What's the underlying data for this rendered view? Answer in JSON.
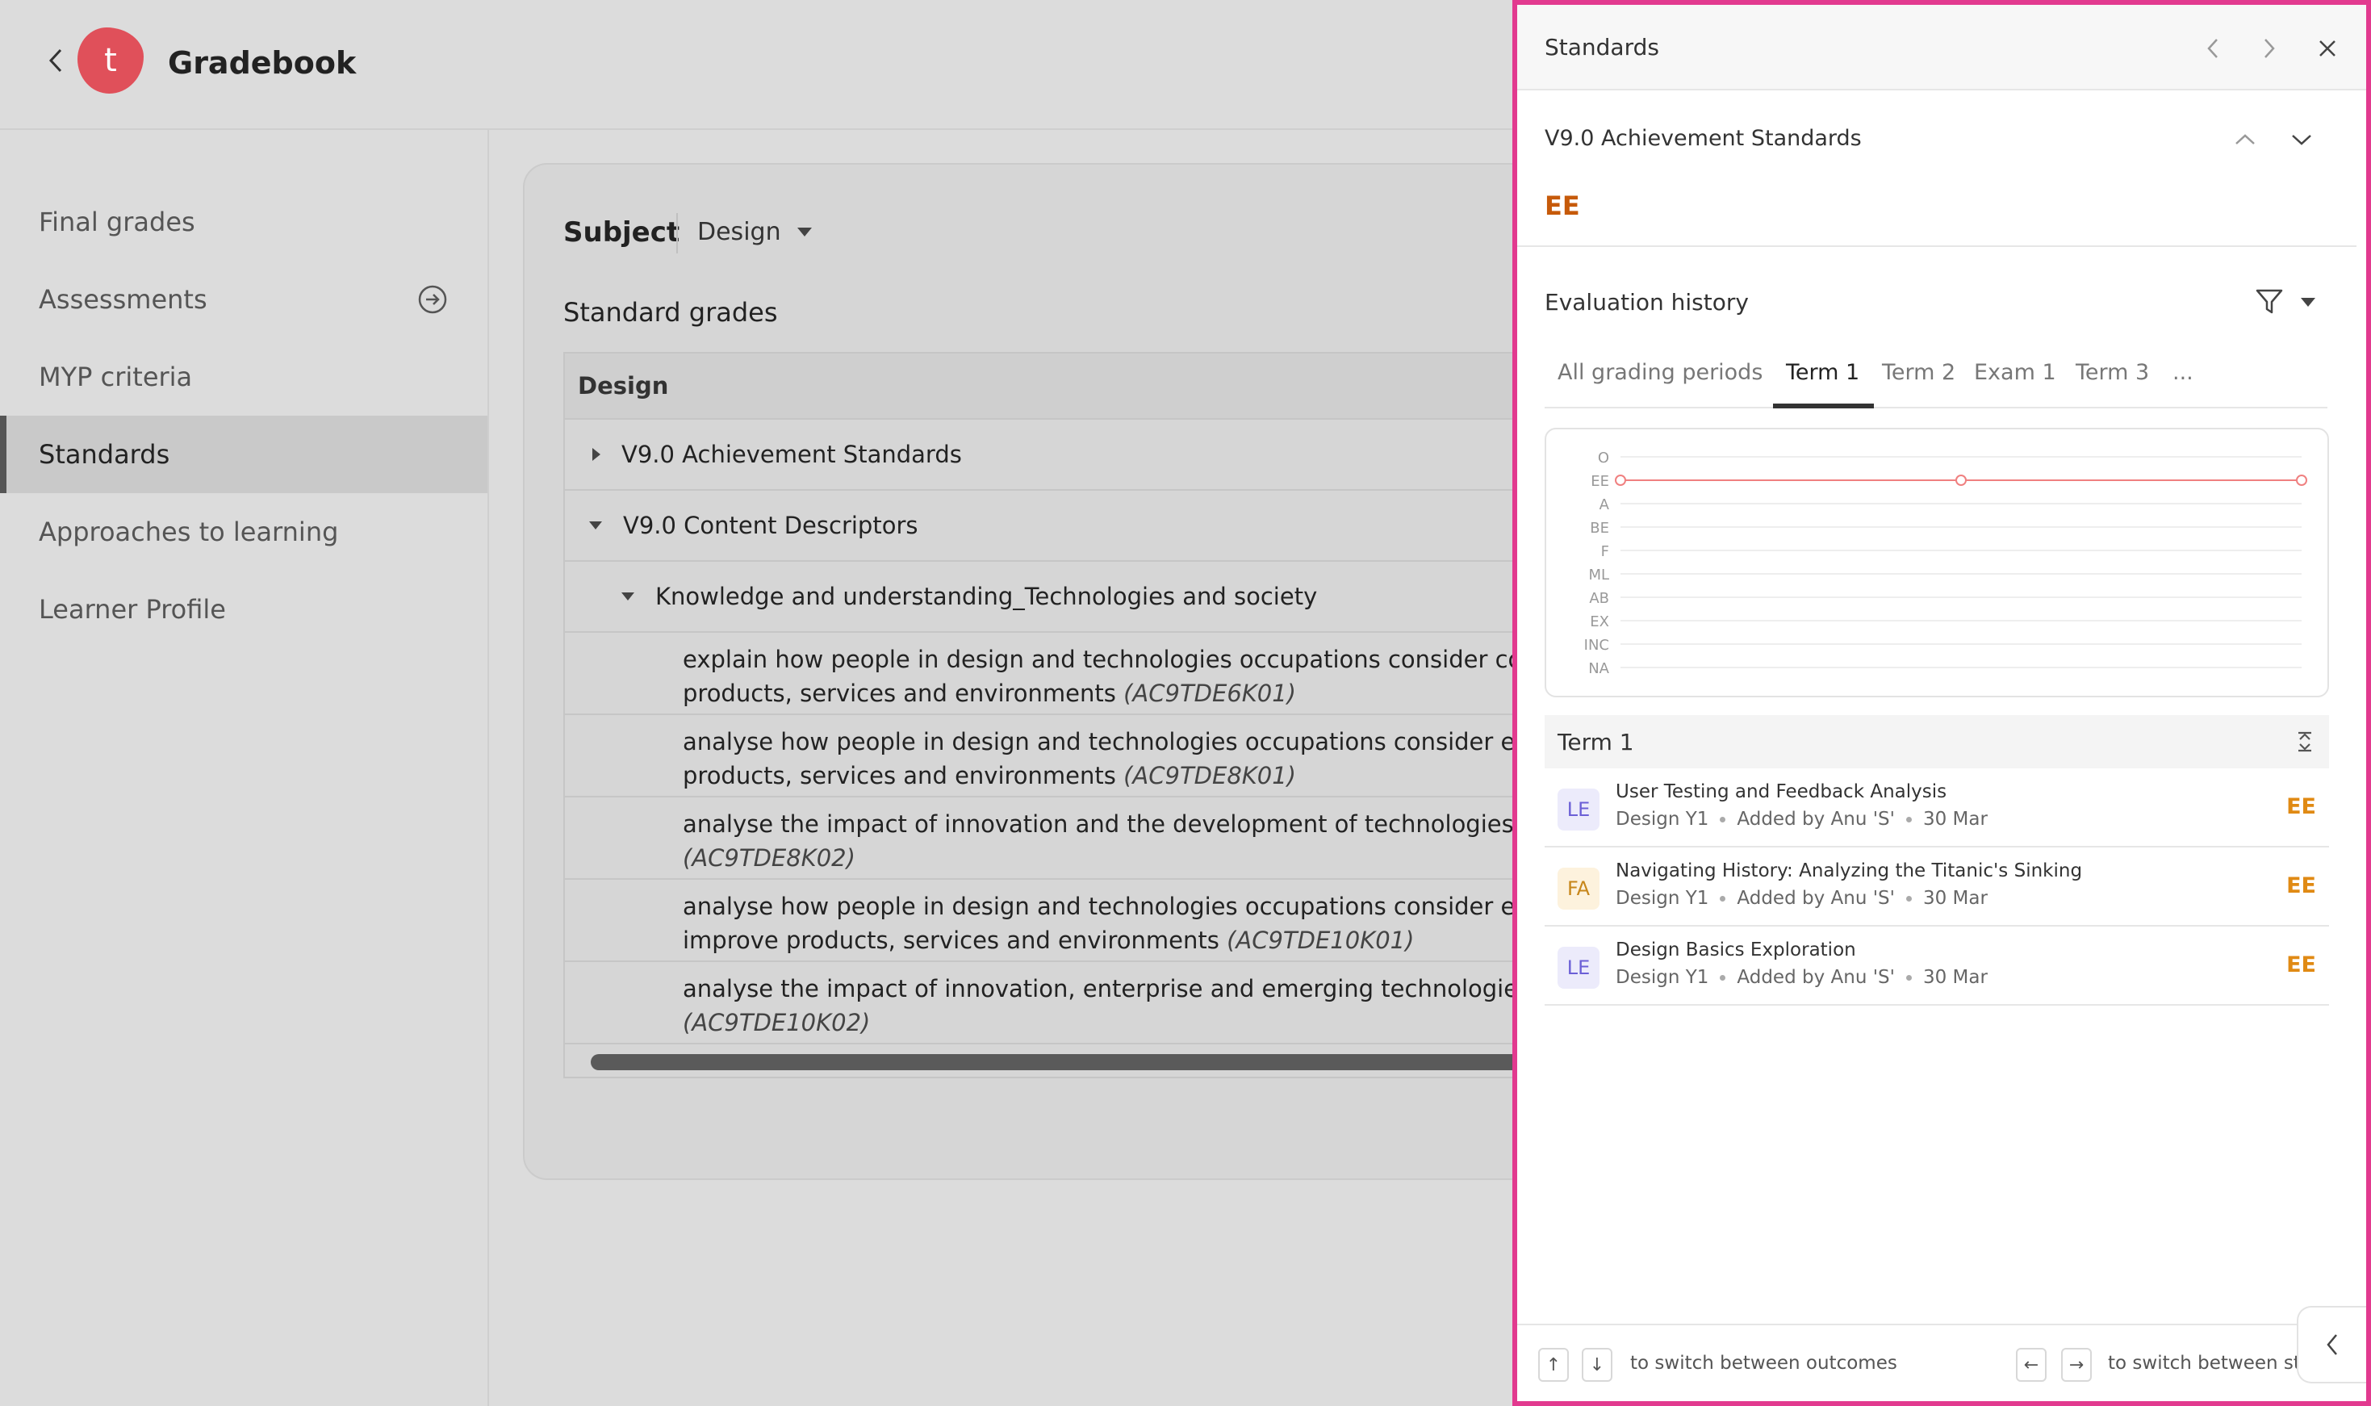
{
  "header": {
    "app_title": "Gradebook",
    "logo_letter": "t"
  },
  "sidebar": {
    "items": [
      {
        "label": "Final grades"
      },
      {
        "label": "Assessments"
      },
      {
        "label": "MYP criteria"
      },
      {
        "label": "Standards"
      },
      {
        "label": "Approaches to learning"
      },
      {
        "label": "Learner Profile"
      }
    ],
    "active": "Standards"
  },
  "main": {
    "subject_label": "Subject",
    "subject_value": "Design",
    "section_title": "Standard grades",
    "grid": {
      "header": "Design",
      "groups": [
        {
          "label": "V9.0 Achievement Standards",
          "expanded": false
        },
        {
          "label": "V9.0 Content Descriptors",
          "expanded": true
        }
      ],
      "subgroup": "Knowledge and understanding_Technologies and society",
      "descriptors": [
        {
          "line1": "explain how people in design and technologies occupations consider competing",
          "line2": "products, services and environments",
          "code": "(AC9TDE6K01)"
        },
        {
          "line1": "analyse how people in design and technologies occupations consider ethical and",
          "line2": "products, services and environments",
          "code": "(AC9TDE8K01)"
        },
        {
          "line1": "analyse the impact of innovation and the development of technologies on design",
          "line2": "",
          "code": "(AC9TDE8K02)"
        },
        {
          "line1": "analyse how people in design and technologies occupations consider ethical, se",
          "line2": "improve products, services and environments",
          "code": "(AC9TDE10K01)"
        },
        {
          "line1": "analyse the impact of innovation, enterprise and emerging technologies on desig",
          "line2": "",
          "code": "(AC9TDE10K02)"
        }
      ]
    }
  },
  "panel": {
    "title": "Standards",
    "standard_name": "V9.0 Achievement Standards",
    "standard_grade": "EE",
    "evaluation_title": "Evaluation history",
    "tabs": [
      "All grading periods",
      "Term 1",
      "Term 2",
      "Exam 1",
      "Term 3",
      "..."
    ],
    "active_tab": "Term 1",
    "chart_data": {
      "type": "line",
      "y_categories": [
        "O",
        "EE",
        "A",
        "BE",
        "F",
        "ML",
        "AB",
        "EX",
        "INC",
        "NA"
      ],
      "series": [
        {
          "values": [
            "EE",
            "EE",
            "EE"
          ]
        }
      ],
      "line_color": "#f08080",
      "grid": true
    },
    "group_label": "Term 1",
    "evaluations": [
      {
        "badge": "LE",
        "type": "le",
        "title": "User Testing and Feedback Analysis",
        "class": "Design Y1",
        "added_by": "Added by Anu 'S'",
        "date": "30 Mar",
        "grade": "EE"
      },
      {
        "badge": "FA",
        "type": "fa",
        "title": "Navigating History: Analyzing the Titanic's Sinking",
        "class": "Design Y1",
        "added_by": "Added by Anu 'S'",
        "date": "30 Mar",
        "grade": "EE"
      },
      {
        "badge": "LE",
        "type": "le",
        "title": "Design Basics Exploration",
        "class": "Design Y1",
        "added_by": "Added by Anu 'S'",
        "date": "30 Mar",
        "grade": "EE"
      }
    ],
    "footer": {
      "outcomes_hint": "to switch between outcomes",
      "students_hint": "to switch between stu",
      "up_key": "↑",
      "down_key": "↓",
      "left_key": "←",
      "right_key": "→"
    }
  }
}
